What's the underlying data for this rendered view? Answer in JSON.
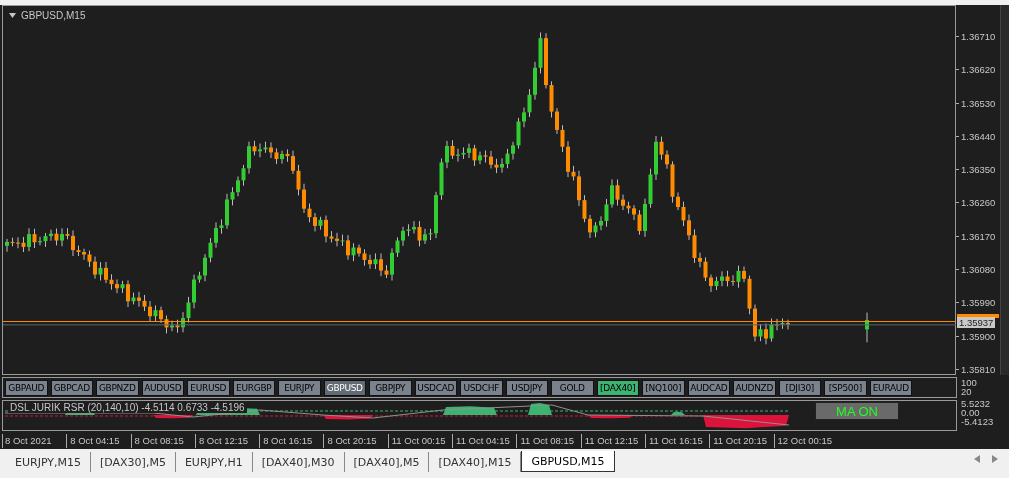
{
  "chart": {
    "title": "GBPUSD,M15",
    "price_ticks": [
      "1.36710",
      "1.36620",
      "1.36530",
      "1.36440",
      "1.36350",
      "1.36260",
      "1.36170",
      "1.36080",
      "1.35990",
      "1.35900",
      "1.35810"
    ],
    "bid_label": "1.35937",
    "symbol_buttons": [
      {
        "label": "GBPAUD",
        "selected": false,
        "highlighted": false
      },
      {
        "label": "GBPCAD",
        "selected": false,
        "highlighted": false
      },
      {
        "label": "GBPNZD",
        "selected": false,
        "highlighted": false
      },
      {
        "label": "AUDUSD",
        "selected": false,
        "highlighted": false
      },
      {
        "label": "EURUSD",
        "selected": false,
        "highlighted": false
      },
      {
        "label": "EURGBP",
        "selected": false,
        "highlighted": false
      },
      {
        "label": "EURJPY",
        "selected": false,
        "highlighted": false
      },
      {
        "label": "GBPUSD",
        "selected": true,
        "highlighted": false
      },
      {
        "label": "GBPJPY",
        "selected": false,
        "highlighted": false
      },
      {
        "label": "USDCAD",
        "selected": false,
        "highlighted": false
      },
      {
        "label": "USDCHF",
        "selected": false,
        "highlighted": false
      },
      {
        "label": "USDJPY",
        "selected": false,
        "highlighted": false
      },
      {
        "label": "GOLD",
        "selected": false,
        "highlighted": false
      },
      {
        "label": "[DAX40]",
        "selected": false,
        "highlighted": true
      },
      {
        "label": "[NQ100]",
        "selected": false,
        "highlighted": false
      },
      {
        "label": "AUDCAD",
        "selected": false,
        "highlighted": false
      },
      {
        "label": "AUDNZD",
        "selected": false,
        "highlighted": false
      },
      {
        "label": "[DJI30]",
        "selected": false,
        "highlighted": false
      },
      {
        "label": "[SP500]",
        "selected": false,
        "highlighted": false
      },
      {
        "label": "EURAUD",
        "selected": false,
        "highlighted": false
      }
    ],
    "button_scale": [
      "100",
      "20"
    ],
    "indicator": {
      "label": "DSL JURIK RSR (20,140,10) -4.5114 0.6733 -4.5196",
      "scale": [
        "5.5232",
        "0.00",
        "-5.4123"
      ],
      "ma_button": "MA ON"
    },
    "time_labels": [
      "8 Oct 2021",
      "8 Oct 04:15",
      "8 Oct 08:15",
      "8 Oct 12:15",
      "8 Oct 16:15",
      "8 Oct 20:15",
      "11 Oct 00:15",
      "11 Oct 04:15",
      "11 Oct 08:15",
      "11 Oct 12:15",
      "11 Oct 16:15",
      "11 Oct 20:15",
      "12 Oct 00:15"
    ]
  },
  "tabs": [
    {
      "label": "EURJPY,M15",
      "selected": false
    },
    {
      "label": "[DAX30],M5",
      "selected": false
    },
    {
      "label": "EURJPY,H1",
      "selected": false
    },
    {
      "label": "[DAX40],M30",
      "selected": false
    },
    {
      "label": "[DAX40],M5",
      "selected": false
    },
    {
      "label": "[DAX40],M15",
      "selected": false
    },
    {
      "label": "GBPUSD,M15",
      "selected": true
    }
  ]
}
